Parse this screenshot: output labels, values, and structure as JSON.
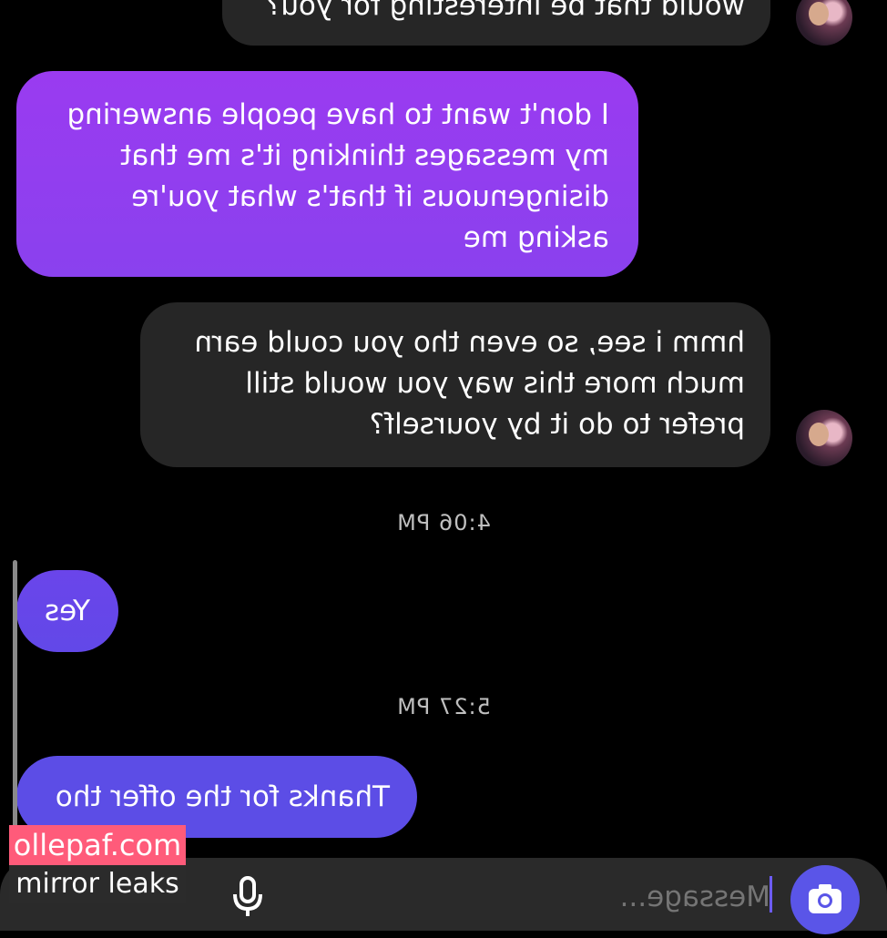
{
  "messages": [
    {
      "text": "would that be interesting for you?"
    },
    {
      "text": "I don't want to have people answering my messages thinking it's me that disingenuous if that's what you're asking me"
    },
    {
      "text": "hmm i see, so even tho you could earn much more this way you would still prefer to do it by yourself?"
    },
    {
      "text": "Yes"
    },
    {
      "text": "Thanks for the offer tho"
    }
  ],
  "timestamps": [
    "4:06 PM",
    "5:27 PM"
  ],
  "composer": {
    "placeholder": "Message..."
  },
  "watermark": {
    "line1": "ollepaf.com",
    "line2": "mirror leaks"
  },
  "colors": {
    "incoming_bubble": "#262626",
    "outgoing_violet": "#9a3bf0",
    "outgoing_purple": "#6a45ea",
    "outgoing_indigo": "#5c4de6",
    "camera_button": "#5a55e8"
  },
  "icons": [
    "camera-icon",
    "microphone-icon",
    "contact-avatar"
  ]
}
